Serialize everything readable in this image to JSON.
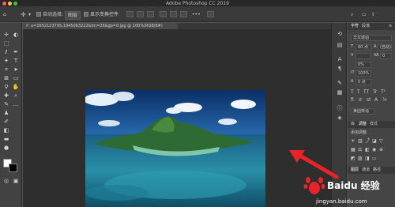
{
  "window": {
    "title": "Adobe Photoshop CC 2019"
  },
  "options_bar": {
    "auto_select_label": "自动选择:",
    "auto_select_value": "图层",
    "show_transform_label": "显示变换控件"
  },
  "document": {
    "tab_title": "u=1652123795,1945063222&fm=26&gp=0.jpg @ 100%(RGB/8#)"
  },
  "right_panel": {
    "tabs_top": [
      "字符",
      "段落"
    ],
    "font_family": "华文琥珀",
    "font_size": "60 点",
    "leading": "(自动)",
    "tracking": "0",
    "baseline": "0%",
    "scale": "100%",
    "baseline_shift": "0 点",
    "language": "美国英语",
    "tabs_mid": [
      "库",
      "调整",
      "样式"
    ],
    "add_adjustment": "添加调整",
    "tabs_bottom": [
      "图层",
      "通道",
      "路径"
    ]
  },
  "watermark": {
    "brand": "Baidu 经验",
    "url": "jingyan.baidu.com"
  },
  "colors": {
    "arrow": "#e8242a",
    "canvas_bg": "#2e2e2e"
  }
}
